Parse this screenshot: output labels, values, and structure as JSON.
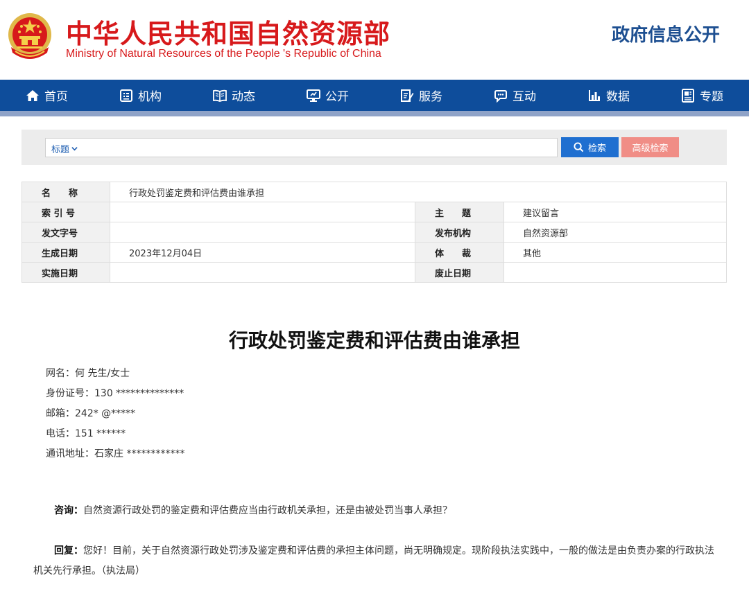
{
  "header": {
    "title_cn": "中华人民共和国自然资源部",
    "title_en": "Ministry of Natural Resources of the People 's Republic of China",
    "right_title": "政府信息公开"
  },
  "nav": {
    "items": [
      {
        "label": "首页",
        "icon": "home-icon"
      },
      {
        "label": "机构",
        "icon": "org-icon"
      },
      {
        "label": "动态",
        "icon": "book-icon"
      },
      {
        "label": "公开",
        "icon": "monitor-icon"
      },
      {
        "label": "服务",
        "icon": "edit-doc-icon"
      },
      {
        "label": "互动",
        "icon": "chat-icon"
      },
      {
        "label": "数据",
        "icon": "bar-chart-icon"
      },
      {
        "label": "专题",
        "icon": "topic-icon"
      }
    ]
  },
  "search": {
    "type_label": "标题",
    "value": "",
    "search_label": "检索",
    "advanced_label": "高级检索"
  },
  "meta": {
    "name_label": "名　　称",
    "name_value": "行政处罚鉴定费和评估费由谁承担",
    "index_label": "索 引 号",
    "index_value": "",
    "subject_label": "主　　题",
    "subject_value": "建议留言",
    "doc_no_label": "发文字号",
    "doc_no_value": "",
    "publisher_label": "发布机构",
    "publisher_value": "自然资源部",
    "created_label": "生成日期",
    "created_value": "2023年12月04日",
    "genre_label": "体　　裁",
    "genre_value": "其他",
    "effective_label": "实施日期",
    "effective_value": "",
    "abolish_label": "废止日期",
    "abolish_value": ""
  },
  "article": {
    "title": "行政处罚鉴定费和评估费由谁承担",
    "info": [
      "网名：何 先生/女士",
      "身份证号：130 **************",
      "邮箱：242* @*****",
      "电话：151 ******",
      "通讯地址：石家庄 ************"
    ],
    "question_label": "咨询：",
    "question_text": "自然资源行政处罚的鉴定费和评估费应当由行政机关承担，还是由被处罚当事人承担？",
    "reply_label": "回复：",
    "reply_text": "您好！目前，关于自然资源行政处罚涉及鉴定费和评估费的承担主体问题，尚无明确规定。现阶段执法实践中，一般的做法是由负责办案的行政执法机关先行承担。（执法局）"
  },
  "colors": {
    "brand_red": "#d7191b",
    "nav_blue": "#0e4d9b",
    "search_blue": "#1f6fd0",
    "advanced_pink": "#f08d86"
  }
}
